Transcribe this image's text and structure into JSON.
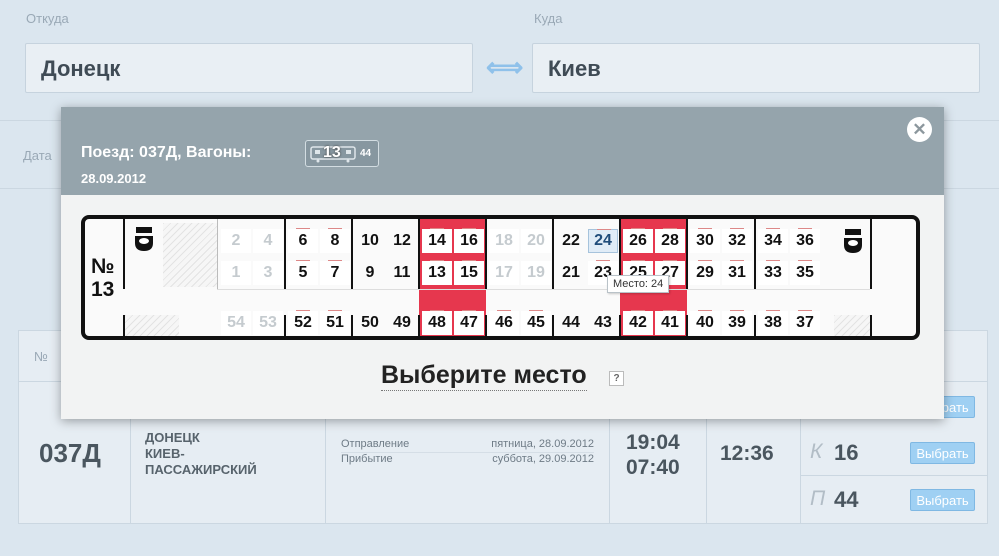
{
  "search": {
    "from_label": "Откуда",
    "from_value": "Донецк",
    "to_label": "Куда",
    "to_value": "Киев",
    "swap_icon": "double-arrow",
    "date_label": "Дата"
  },
  "results": {
    "header_num": "№",
    "train": "037Д",
    "route_from": "ДОНЕЦК",
    "route_to_1": "КИЕВ-",
    "route_to_2": "ПАССАЖИРСКИЙ",
    "departure_label": "Отправление",
    "departure_date": "пятница, 28.09.2012",
    "arrival_label": "Прибытие",
    "arrival_date": "суббота, 29.09.2012",
    "departure_time": "19:04",
    "arrival_time": "07:40",
    "duration": "12:36",
    "classes": [
      {
        "class": "К",
        "count": "16",
        "button": "Выбрать"
      },
      {
        "class": "П",
        "count": "44",
        "button": "Выбрать"
      }
    ],
    "top_button": "Выбрать"
  },
  "modal": {
    "title": "Поезд: 037Д, Вагоны:",
    "date": "28.09.2012",
    "wagon_number": "13",
    "wagon_seats": "44",
    "close_icon": "close",
    "car_label_line1": "№",
    "car_label_line2": "13",
    "tooltip": "Место: 24",
    "choose_text": "Выберите место",
    "help": "?",
    "booked_color": "#e6374e",
    "seats_upper_top": [
      "2",
      "4",
      "6",
      "8",
      "10",
      "12",
      "14",
      "16",
      "18",
      "20",
      "22",
      "24",
      "26",
      "28",
      "30",
      "32",
      "34",
      "36"
    ],
    "seats_upper_bottom": [
      "1",
      "3",
      "5",
      "7",
      "9",
      "11",
      "13",
      "15",
      "17",
      "19",
      "21",
      "23",
      "25",
      "27",
      "29",
      "31",
      "33",
      "35"
    ],
    "seats_side": [
      "54",
      "53",
      "52",
      "51",
      "50",
      "49",
      "48",
      "47",
      "46",
      "45",
      "44",
      "43",
      "42",
      "41",
      "40",
      "39",
      "38",
      "37"
    ],
    "disabled": [
      "2",
      "4",
      "1",
      "3",
      "18",
      "20",
      "17",
      "19",
      "54",
      "53"
    ],
    "booked": [
      "10",
      "12",
      "9",
      "11",
      "50",
      "49",
      "22",
      "21",
      "44",
      "43"
    ],
    "selected": "24"
  }
}
